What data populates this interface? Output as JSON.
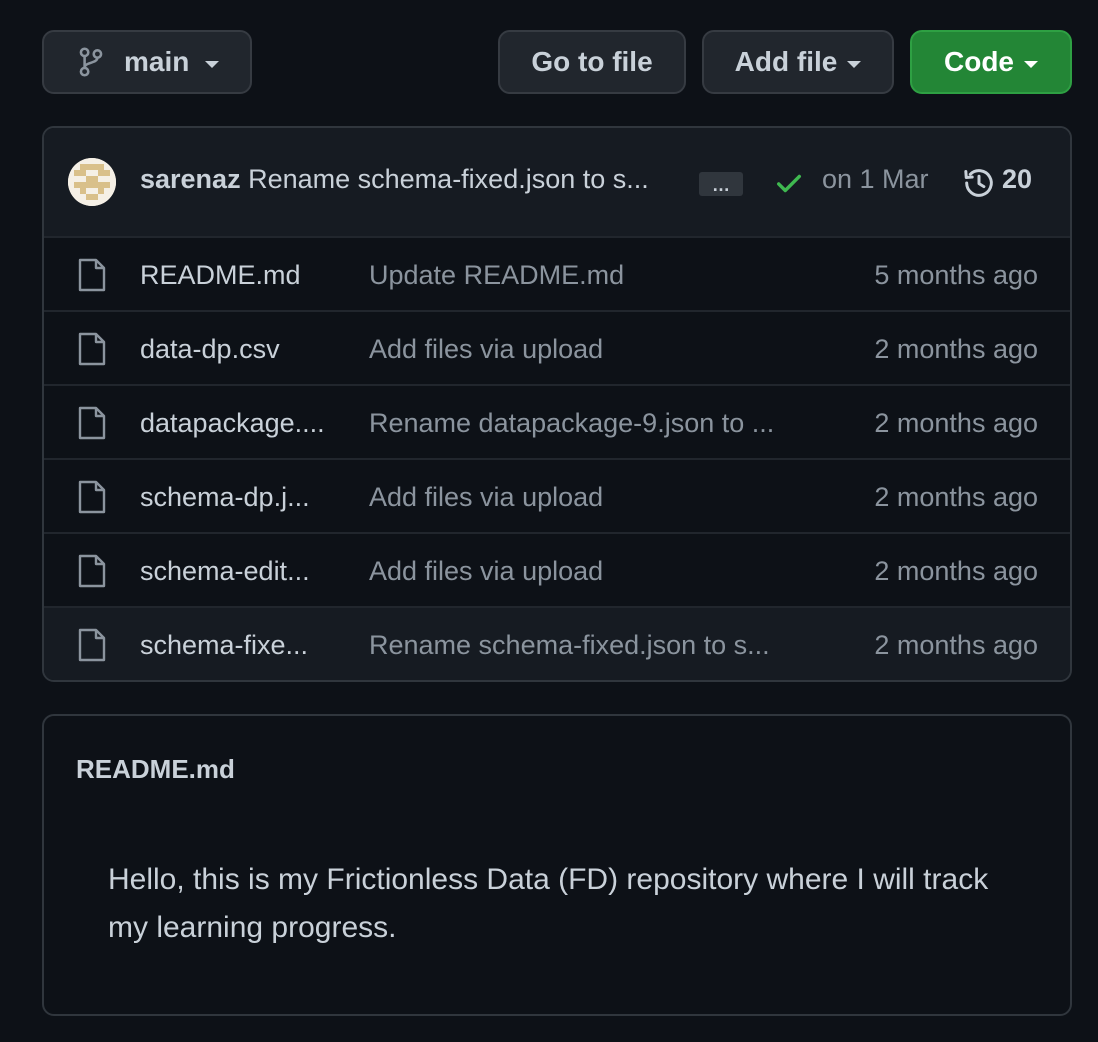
{
  "toolbar": {
    "branch_label": "main",
    "goto_file_label": "Go to file",
    "add_file_label": "Add file",
    "code_label": "Code"
  },
  "latest_commit": {
    "author": "sarenaz",
    "message": "Rename schema-fixed.json to s...",
    "ellipsis": "…",
    "status_icon": "check-icon",
    "date": "on 1 Mar",
    "history_icon": "history-icon",
    "commit_count": "20"
  },
  "files": [
    {
      "name": "README.md",
      "message": "Update README.md",
      "age": "5 months ago"
    },
    {
      "name": "data-dp.csv",
      "message": "Add files via upload",
      "age": "2 months ago"
    },
    {
      "name": "datapackage....",
      "message": "Rename datapackage-9.json to ...",
      "age": "2 months ago"
    },
    {
      "name": "schema-dp.j...",
      "message": "Add files via upload",
      "age": "2 months ago"
    },
    {
      "name": "schema-edit...",
      "message": "Add files via upload",
      "age": "2 months ago"
    },
    {
      "name": "schema-fixe...",
      "message": "Rename schema-fixed.json to s...",
      "age": "2 months ago"
    }
  ],
  "readme": {
    "title": "README.md",
    "body": "Hello, this is my Frictionless Data (FD) repository where I will track my learning progress."
  },
  "colors": {
    "background": "#0d1117",
    "code_button": "#238636",
    "success_check": "#3fb950",
    "muted_text": "#8b949e"
  }
}
